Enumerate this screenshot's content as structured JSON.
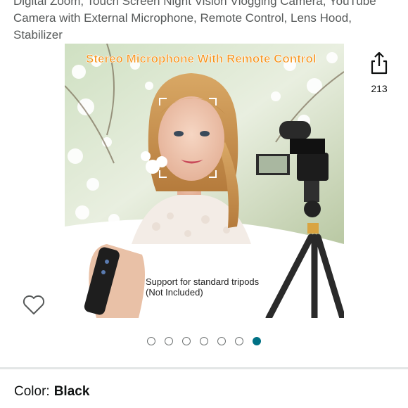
{
  "product": {
    "title": "Digital Zoom, Touch Screen Night Vision Vlogging Camera, YouTube Camera with External Microphone, Remote Control, Lens Hood, Stabilizer"
  },
  "hero_image": {
    "headline": "Stereo Microphone With Remote Control",
    "caption_line1": "Support for standard tripods",
    "caption_line2": "(Not Included)"
  },
  "share": {
    "icon": "share-icon",
    "count": "213"
  },
  "wishlist": {
    "icon": "heart-outline-icon"
  },
  "carousel": {
    "total": 7,
    "active_index": 6
  },
  "variation": {
    "label": "Color:",
    "value": "Black"
  },
  "colors": {
    "accent": "#007185",
    "headline_text": "#f7941d",
    "title_text": "#565959"
  }
}
